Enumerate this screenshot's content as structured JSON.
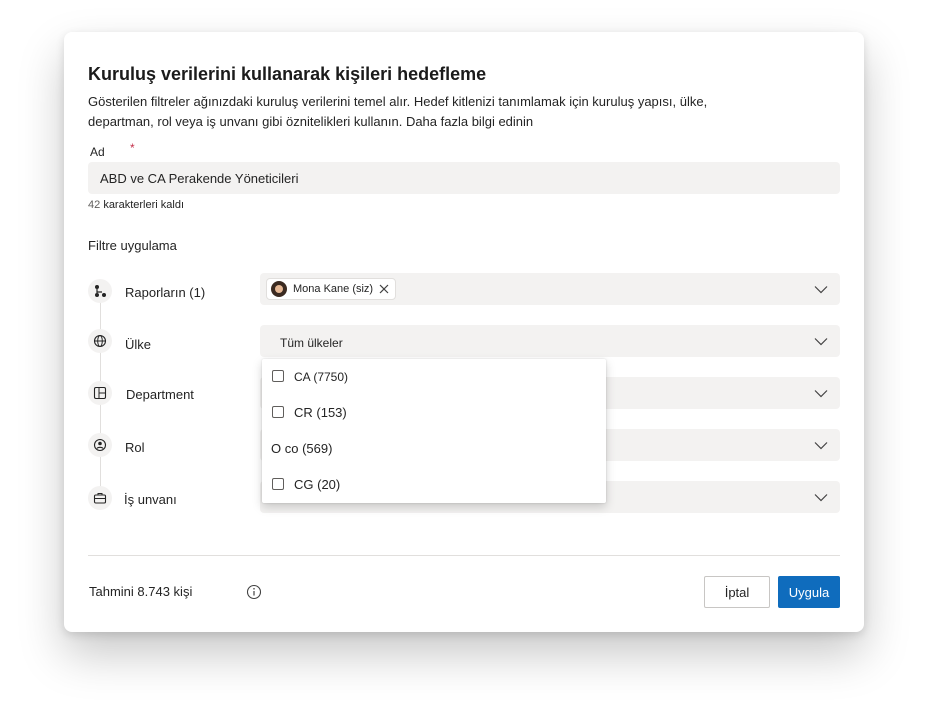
{
  "dialog": {
    "title": "Kuruluş verilerini kullanarak kişileri hedefleme",
    "description": "Gösterilen filtreler ağınızdaki kuruluş verilerini temel alır. Hedef kitlenizi tanımlamak için kuruluş yapısı, ülke, departman, rol veya iş unvanı gibi öznitelikleri kullanın. Daha fazla bilgi edinin"
  },
  "name_field": {
    "label": "Ad",
    "required_mark": "*",
    "value": "ABD ve CA Perakende Yöneticileri",
    "chars_left_count": "42",
    "chars_left_text": "karakterleri kaldı"
  },
  "filters": {
    "title": "Filtre uygulama",
    "rows": [
      {
        "label": "Raporların (1)",
        "icon": "org-chart-icon"
      },
      {
        "label": "Ülke",
        "icon": "globe-icon",
        "value": "Tüm ülkeler"
      },
      {
        "label": "Department",
        "icon": "department-icon"
      },
      {
        "label": "Rol",
        "icon": "role-icon"
      },
      {
        "label": "İş unvanı",
        "icon": "briefcase-icon"
      }
    ],
    "reports_chip": {
      "name": "Mona Kane (siz)"
    }
  },
  "country_dropdown": {
    "options": [
      {
        "label": "CA (7750)",
        "checked": false
      },
      {
        "label": "CR (153)",
        "checked": false
      },
      {
        "label": "O co (569)",
        "checked": false
      },
      {
        "label": "CG (20)",
        "checked": false
      }
    ]
  },
  "footer": {
    "estimate": "Tahmini 8.743 kişi",
    "cancel_label": "İptal",
    "apply_label": "Uygula"
  },
  "colors": {
    "primary": "#0f6cbd",
    "required": "#c4314b",
    "field_background": "#f3f2f1"
  }
}
